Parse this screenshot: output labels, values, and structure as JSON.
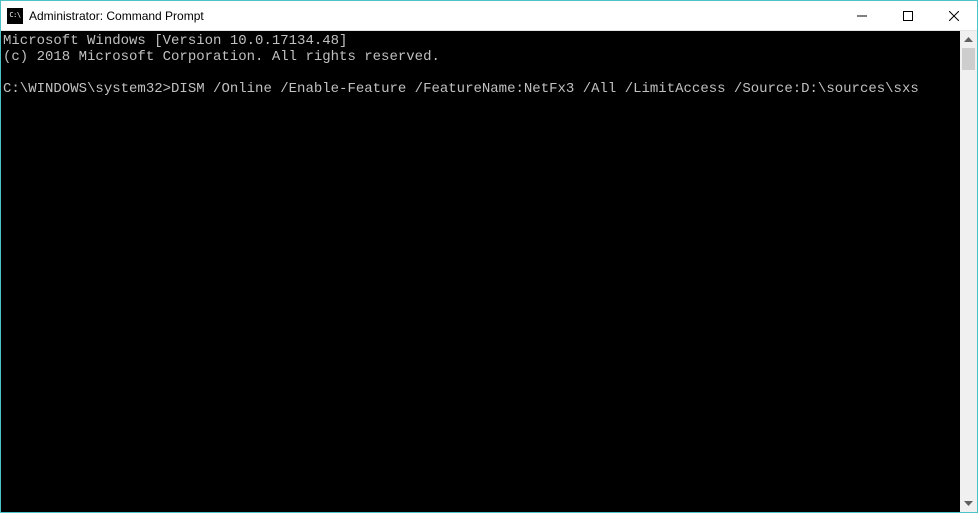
{
  "window": {
    "title": "Administrator: Command Prompt",
    "icon_label": "C:\\"
  },
  "terminal": {
    "line1": "Microsoft Windows [Version 10.0.17134.48]",
    "line2": "(c) 2018 Microsoft Corporation. All rights reserved.",
    "blank": "",
    "prompt": "C:\\WINDOWS\\system32>",
    "command": "DISM /Online /Enable-Feature /FeatureName:NetFx3 /All /LimitAccess /Source:D:\\sources\\sxs"
  }
}
